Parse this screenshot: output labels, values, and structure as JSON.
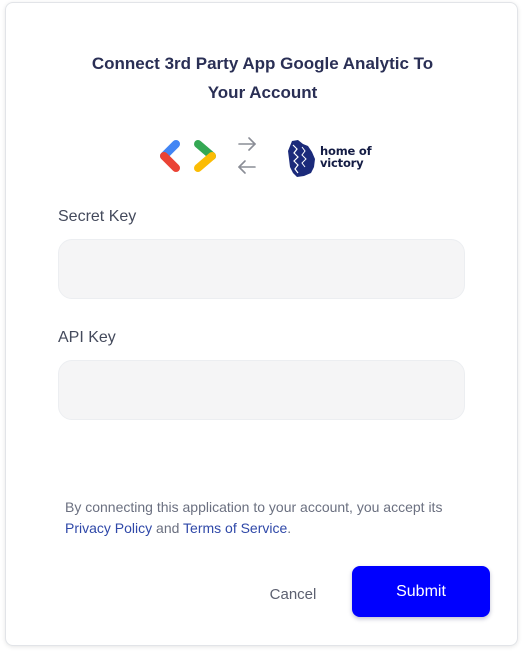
{
  "dialog": {
    "title_line1": "Connect 3rd Party App Google Analytic To",
    "title_line2": "Your Account"
  },
  "logos": {
    "app_icon": "google-analytics-logo",
    "exchange_icon": "swap-arrows-icon",
    "brand_icon": "home-of-victory-logo",
    "brand_line1": "home of",
    "brand_line2": "victory"
  },
  "form": {
    "secret_key": {
      "label": "Secret Key",
      "value": "",
      "placeholder": ""
    },
    "api_key": {
      "label": "API Key",
      "value": "",
      "placeholder": ""
    }
  },
  "consent": {
    "text_before": "By connecting this application to your account, you accept its",
    "privacy_link": "Privacy Policy",
    "conjunction": "and",
    "terms_link": "Terms of Service",
    "period": "."
  },
  "actions": {
    "cancel_label": "Cancel",
    "submit_label": "Submit"
  },
  "colors": {
    "primary": "#0000ff",
    "title": "#2a2f55",
    "link": "#2f48a8",
    "input_bg": "#f5f5f6"
  }
}
